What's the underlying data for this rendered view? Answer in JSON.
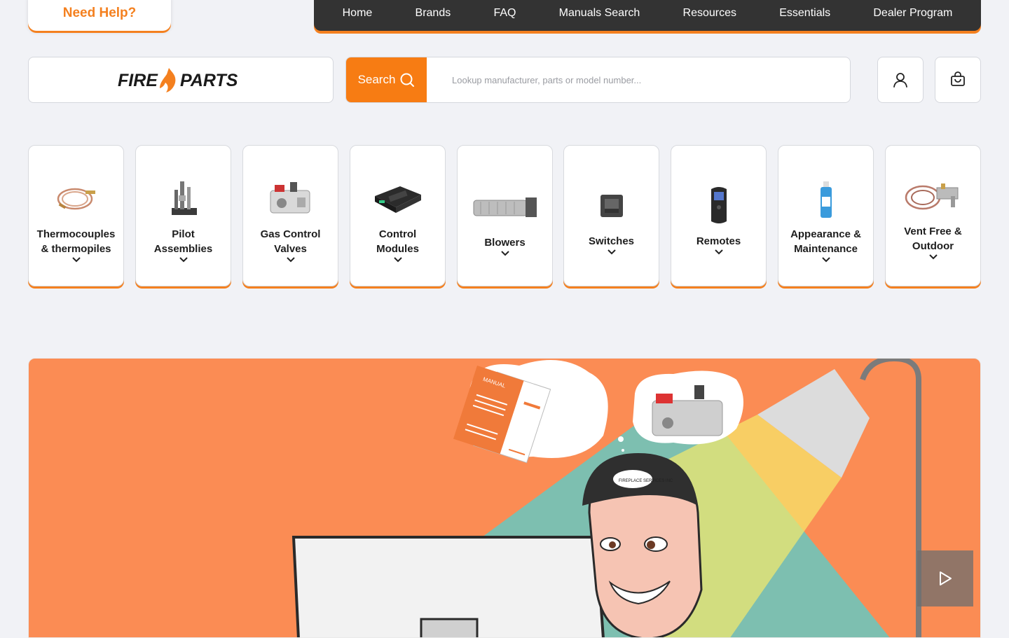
{
  "help": {
    "label": "Need Help?"
  },
  "nav": {
    "items": [
      "Home",
      "Brands",
      "FAQ",
      "Manuals Search",
      "Resources",
      "Essentials",
      "Dealer Program"
    ]
  },
  "logo": {
    "part1": "FIRE",
    "part2": "PARTS"
  },
  "search": {
    "button_label": "Search",
    "placeholder": "Lookup manufacturer, parts or model number..."
  },
  "categories": [
    {
      "line1": "Thermocouples",
      "line2": "& thermopiles",
      "icon": "thermocouple-icon"
    },
    {
      "line1": "Pilot",
      "line2": "Assemblies",
      "icon": "pilot-assembly-icon"
    },
    {
      "line1": "Gas Control",
      "line2": "Valves",
      "icon": "gas-valve-icon"
    },
    {
      "line1": "Control",
      "line2": "Modules",
      "icon": "control-module-icon"
    },
    {
      "line1": "Blowers",
      "line2": "",
      "icon": "blower-icon"
    },
    {
      "line1": "Switches",
      "line2": "",
      "icon": "switch-icon"
    },
    {
      "line1": "Remotes",
      "line2": "",
      "icon": "remote-icon"
    },
    {
      "line1": "Appearance &",
      "line2": "Maintenance",
      "icon": "spray-bottle-icon"
    },
    {
      "line1": "Vent Free &",
      "line2": "Outdoor",
      "icon": "vent-free-kit-icon"
    }
  ],
  "hero": {
    "manual_text": "MANUAL",
    "cap_text": "FIREPLACE SERVICES INC"
  },
  "colors": {
    "accent": "#f77c13",
    "nav_bg": "#333333",
    "hero_bg": "#fb8c54",
    "page_bg": "#f1f2f6"
  }
}
